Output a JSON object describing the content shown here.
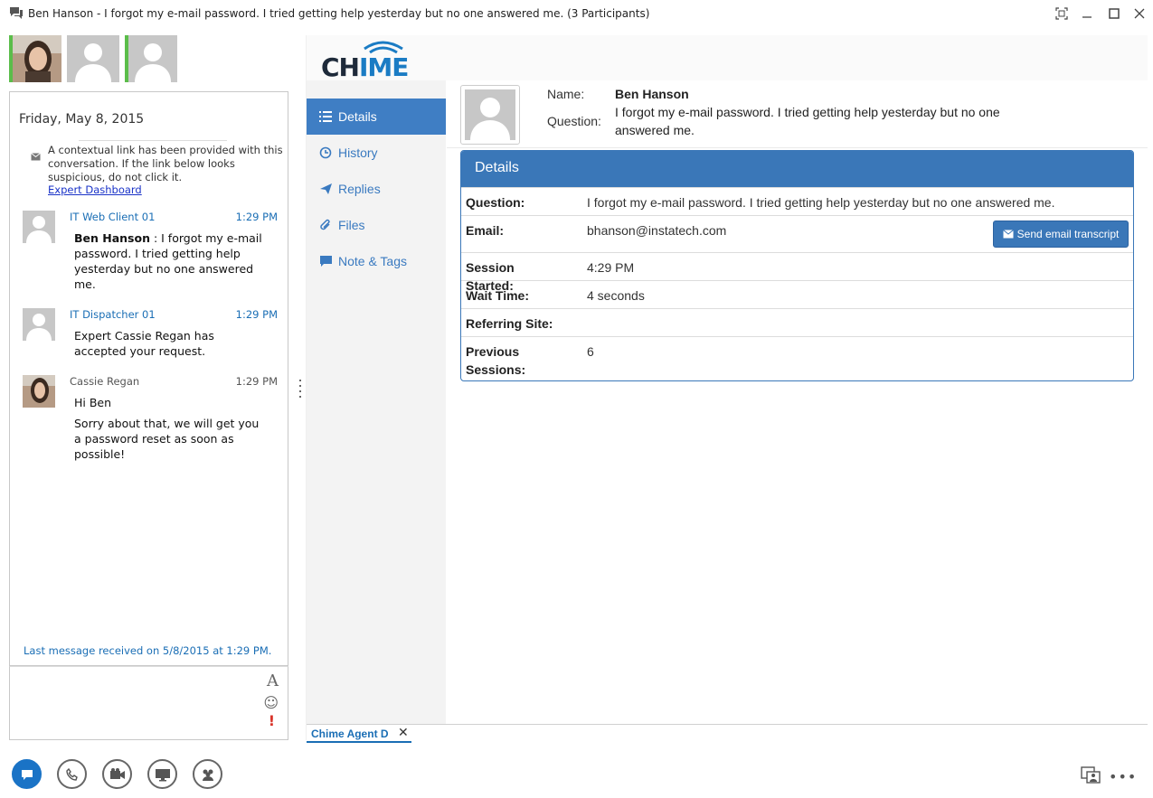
{
  "window": {
    "title": "Ben Hanson - I forgot my e-mail password. I tried getting help yesterday but no one answered me. (3 Participants)"
  },
  "conversation": {
    "date": "Friday, May 8, 2015",
    "context_notice": "A contextual link has been provided with this conversation. If the link below looks suspicious, do not click it.",
    "context_link": "Expert Dashboard",
    "messages": [
      {
        "sender": "IT Web Client 01",
        "time": "1:29 PM",
        "author": "Ben Hanson",
        "text": " : I forgot my e-mail password. I tried getting help yesterday but no one answered me."
      },
      {
        "sender": "IT Dispatcher 01",
        "time": "1:29 PM",
        "text": "Expert Cassie Regan has accepted your request."
      },
      {
        "sender": "Cassie Regan",
        "time": "1:29 PM",
        "line1": "Hi Ben",
        "line2": "Sorry about that, we will get you a password reset as soon as possible!"
      }
    ],
    "last_message": "Last message received on 5/8/2015 at 1:29 PM."
  },
  "chime": {
    "logo_prefix": "CH",
    "logo_accent": "IME",
    "nav": [
      {
        "label": "Details",
        "icon": "list-icon"
      },
      {
        "label": "History",
        "icon": "clock-icon"
      },
      {
        "label": "Replies",
        "icon": "send-icon"
      },
      {
        "label": "Files",
        "icon": "paperclip-icon"
      },
      {
        "label": "Note & Tags",
        "icon": "comment-icon"
      }
    ],
    "profile": {
      "name_label": "Name:",
      "name": "Ben Hanson",
      "question_label": "Question:",
      "question": "I forgot my e-mail password. I tried getting help yesterday but no one answered me."
    },
    "details": {
      "heading": "Details",
      "rows": [
        {
          "key": "Question:",
          "value": "I forgot my e-mail password. I tried getting help yesterday but no one answered me."
        },
        {
          "key": "Email:",
          "value": "bhanson@instatech.com"
        },
        {
          "key": "Session Started:",
          "value": "4:29 PM"
        },
        {
          "key": "Wait Time:",
          "value": "4 seconds"
        },
        {
          "key": "Referring Site:",
          "value": ""
        },
        {
          "key": "Previous Sessions:",
          "value": "6"
        }
      ],
      "send_button": "Send email transcript"
    },
    "tab": {
      "label": "Chime Agent D"
    }
  },
  "colors": {
    "accent": "#3a77b8",
    "link": "#1a6eb5",
    "presence": "#5bbd4a",
    "active_call_button": "#1a73c6"
  }
}
